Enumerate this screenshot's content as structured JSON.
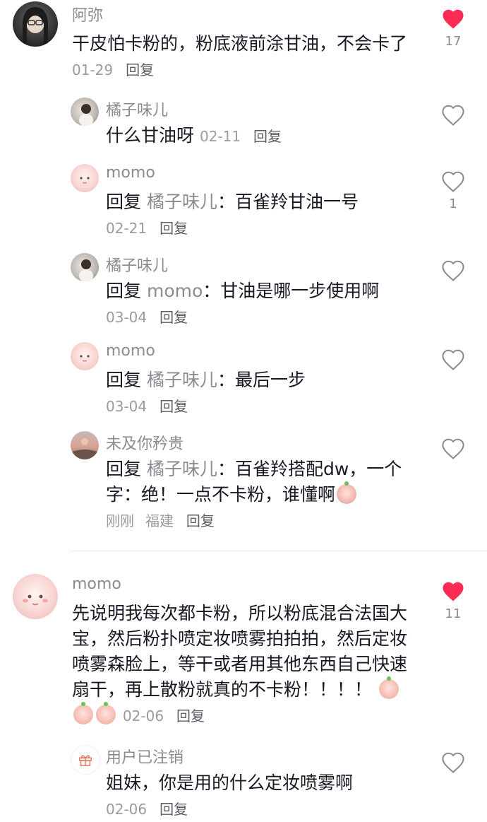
{
  "comments": [
    {
      "user": "阿弥",
      "text": "干皮怕卡粉的，粉底液前涂甘油，不会卡了",
      "date": "01-29",
      "reply": "回复",
      "likes": "17",
      "liked": true
    }
  ],
  "replies": [
    {
      "user": "橘子味儿",
      "text": "什么甘油呀",
      "date": "02-11",
      "reply": "回复"
    },
    {
      "user": "momo",
      "prefix": "回复",
      "target": "橘子味儿",
      "text": "：百雀羚甘油一号",
      "date": "02-21",
      "reply": "回复",
      "likes": "1"
    },
    {
      "user": "橘子味儿",
      "prefix": "回复",
      "target": "momo",
      "text": "：甘油是哪一步使用啊",
      "date": "03-04",
      "reply": "回复"
    },
    {
      "user": "momo",
      "prefix": "回复",
      "target": "橘子味儿",
      "text": "：最后一步",
      "date": "03-04",
      "reply": "回复"
    },
    {
      "user": "未及你矜贵",
      "prefix": "回复",
      "target": "橘子味儿",
      "text": "：百雀羚搭配dw，一个字：绝！一点不卡粉，谁懂啊",
      "date": "刚刚",
      "location": "福建",
      "reply": "回复"
    }
  ],
  "comment2": {
    "user": "momo",
    "text": "先说明我每次都卡粉，所以粉底混合法国大宝，然后粉扑喷定妆喷雾拍拍拍，然后定妆喷雾森脸上，等干或者用其他东西自己快速扇干，再上散粉就真的不卡粉！！！！",
    "date": "02-06",
    "reply": "回复",
    "likes": "11",
    "liked": true
  },
  "reply_last": {
    "user": "用户已注销",
    "text": "姐妹，你是用的什么定妆喷雾啊",
    "date": "02-06",
    "reply": "回复"
  },
  "colors": {
    "liked": "#fe2c55",
    "outline": "#8a8b91"
  },
  "icons": {
    "like": "heart-icon",
    "liked": "heart-filled-icon",
    "gift": "gift-icon",
    "emoji": "peach-emoji-icon"
  }
}
